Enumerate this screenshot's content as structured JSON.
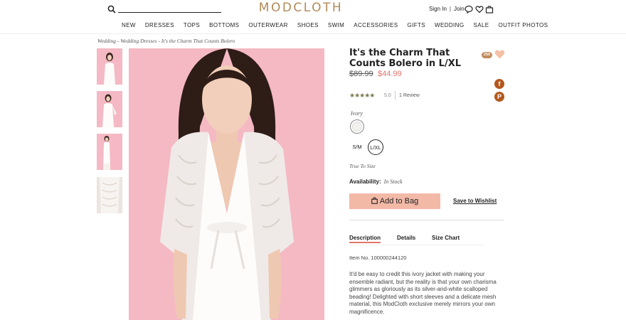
{
  "header": {
    "logo": "MODCLOTH",
    "sign_in": "Sign In",
    "join": "Join",
    "separator": "|"
  },
  "nav": [
    "NEW",
    "DRESSES",
    "TOPS",
    "BOTTOMS",
    "OUTERWEAR",
    "SHOES",
    "SWIM",
    "ACCESSORIES",
    "GIFTS",
    "WEDDING",
    "SALE",
    "OUTFIT PHOTOS"
  ],
  "breadcrumb": "Wedding - Wedding Dresses - It's the Charm That Counts Bolero",
  "product": {
    "title": "It's the Charm That Counts Bolero in L/XL",
    "badge": "259",
    "price_original": "$89.99",
    "price_sale": "$44.99",
    "stars": "★★★★★",
    "rating": "5.0",
    "reviews": "1 Review",
    "color_label": "Ivory",
    "sizes": [
      "S/M",
      "L/XL"
    ],
    "selected_size": "L/XL",
    "fit": "True To Size",
    "availability_label": "Availability:",
    "availability_value": "In Stock",
    "add_to_bag": "Add to Bag",
    "save_to_wishlist": "Save to Wishlist",
    "share_facebook": "f",
    "share_pinterest": "P"
  },
  "tabs": [
    "Description",
    "Details",
    "Size Chart"
  ],
  "item_no": "Item No. 100000244120",
  "description": "It'd be easy to credit this ivory jacket with making your ensemble radiant, but the reality is that your own charisma glimmers as gloriously as its silver-and-white scalloped beading! Delighted with short sleeves and a delicate mesh material, this ModCloth exclusive merely mirrors your own magnificence.",
  "colors": {
    "brand": "#b08a57",
    "sale_price": "#e0756c",
    "add_button": "#f3b9a7",
    "heart": "#f5c1a6",
    "social": "#b3581d",
    "image_background": "#f5b9c3"
  }
}
